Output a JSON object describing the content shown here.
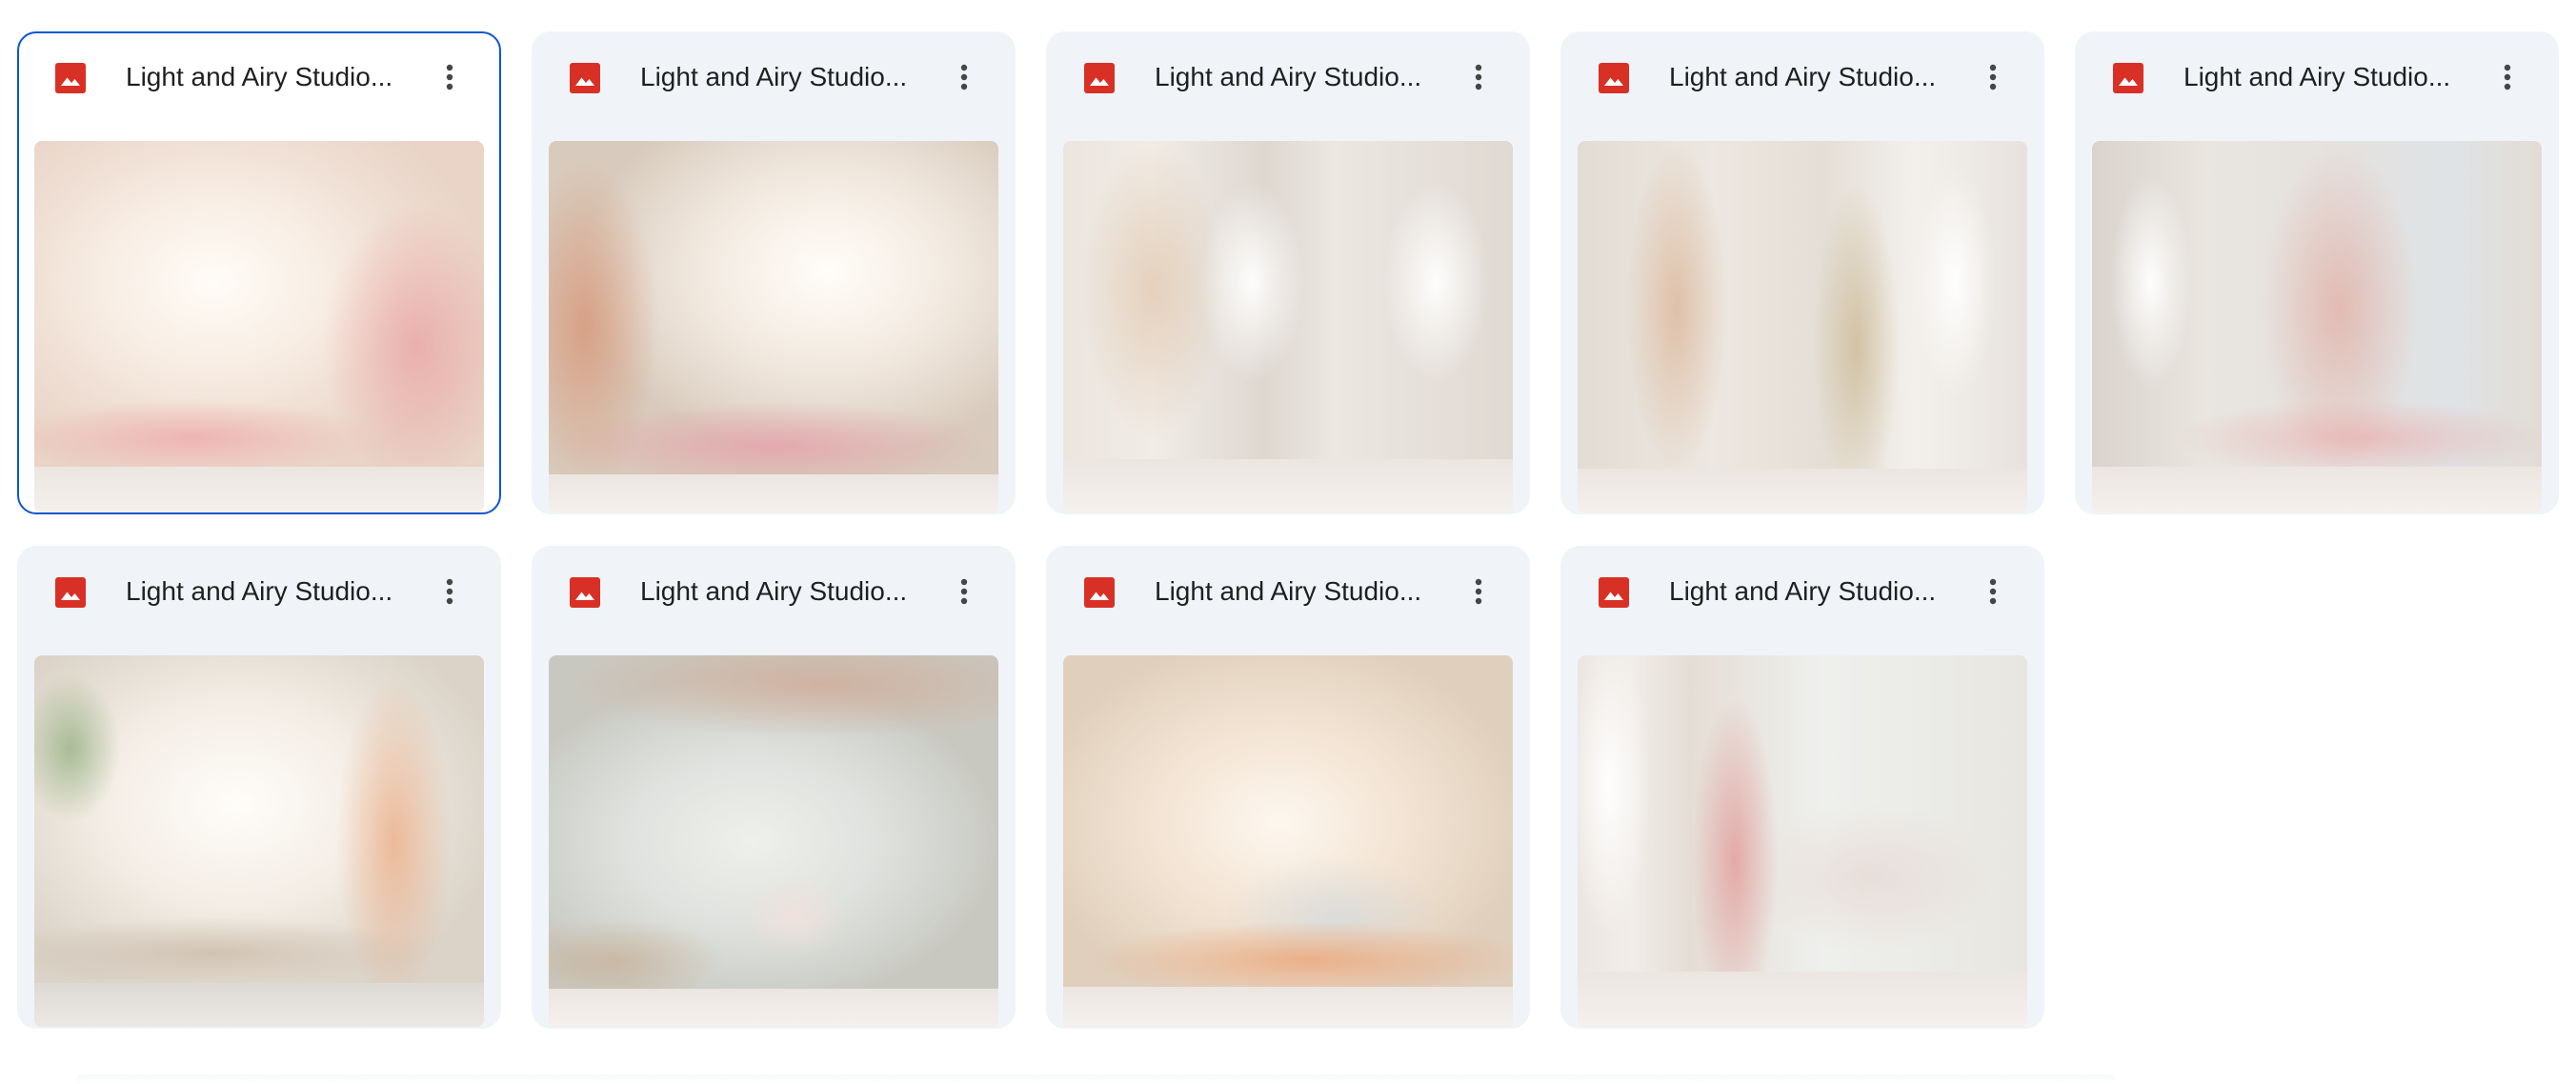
{
  "files": [
    {
      "title": "Light and Airy Studio...",
      "icon": "image-file-icon",
      "selected": true
    },
    {
      "title": "Light and Airy Studio...",
      "icon": "image-file-icon",
      "selected": false
    },
    {
      "title": "Light and Airy Studio...",
      "icon": "image-file-icon",
      "selected": false
    },
    {
      "title": "Light and Airy Studio...",
      "icon": "image-file-icon",
      "selected": false
    },
    {
      "title": "Light and Airy Studio...",
      "icon": "image-file-icon",
      "selected": false
    },
    {
      "title": "Light and Airy Studio...",
      "icon": "image-file-icon",
      "selected": false
    },
    {
      "title": "Light and Airy Studio...",
      "icon": "image-file-icon",
      "selected": false
    },
    {
      "title": "Light and Airy Studio...",
      "icon": "image-file-icon",
      "selected": false
    },
    {
      "title": "Light and Airy Studio...",
      "icon": "image-file-icon",
      "selected": false
    }
  ],
  "colors": {
    "card_background": "#f0f4f9",
    "selected_border": "#0b57d0",
    "image_icon": "#d93025",
    "title_text": "#1f1f1f"
  }
}
